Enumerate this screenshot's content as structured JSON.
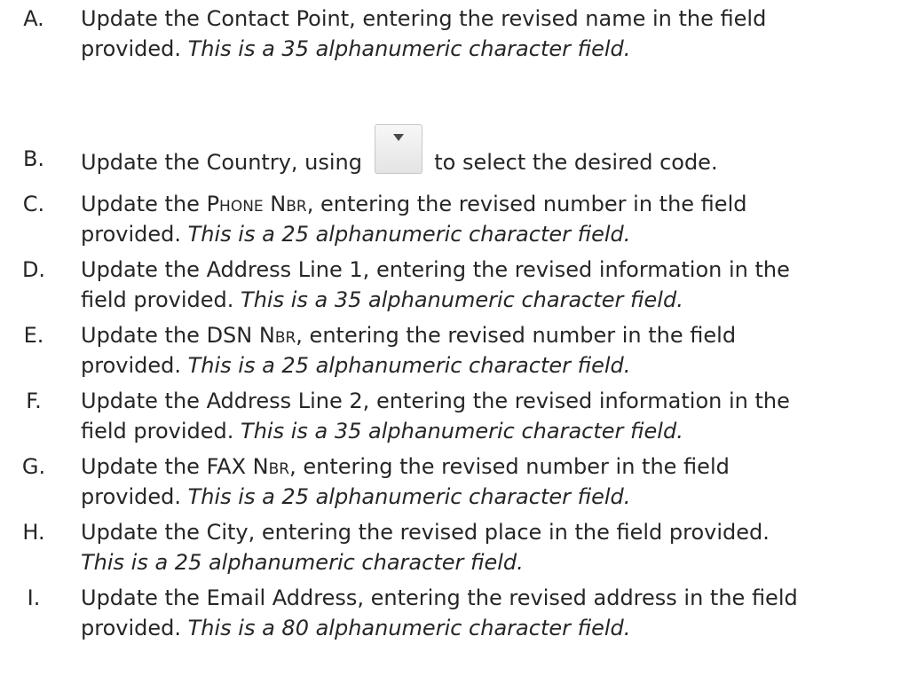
{
  "steps": [
    {
      "letter": "A.",
      "line1": "Update the Contact Point, entering the revised name in the field",
      "line2_prefix": "provided. ",
      "note": "This is a 35 alphanumeric character field."
    },
    {
      "letter": "B.",
      "before_icon": "Update the Country, using ",
      "after_icon": " to select the desired code.",
      "icon": "dropdown-arrow-icon"
    },
    {
      "letter": "C.",
      "line1_prefix": "Update the ",
      "sc_label": "Phone Nbr",
      "line1_suffix": ", entering the revised number in the field",
      "line2_prefix": "provided. ",
      "note": "This is a 25 alphanumeric character field."
    },
    {
      "letter": "D.",
      "line1": "Update the Address Line 1, entering the revised information in the",
      "line2_prefix": "field provided. ",
      "note": "This is a 35 alphanumeric character field."
    },
    {
      "letter": "E.",
      "line1_prefix": "Update the DSN ",
      "sc_label": "Nbr",
      "line1_suffix": ", entering the revised number in the field",
      "line2_prefix": "provided. ",
      "note": "This is a 25 alphanumeric character field."
    },
    {
      "letter": "F.",
      "line1": "Update the Address Line 2, entering the revised information in the",
      "line2_prefix": "field provided. ",
      "note": "This is a 35 alphanumeric character field."
    },
    {
      "letter": "G.",
      "line1_prefix": "Update the FAX ",
      "sc_label": "Nbr",
      "line1_suffix": ", entering the revised number in the field",
      "line2_prefix": "provided. ",
      "note": "This is a 25 alphanumeric character field."
    },
    {
      "letter": "H.",
      "line1": "Update the City, entering the revised place in the field provided.",
      "note": "This is a 25 alphanumeric character field."
    },
    {
      "letter": "I.",
      "line1": "Update the Email Address, entering the revised address in the field",
      "line2_prefix": "provided. ",
      "note": "This is a 80 alphanumeric character field."
    }
  ]
}
